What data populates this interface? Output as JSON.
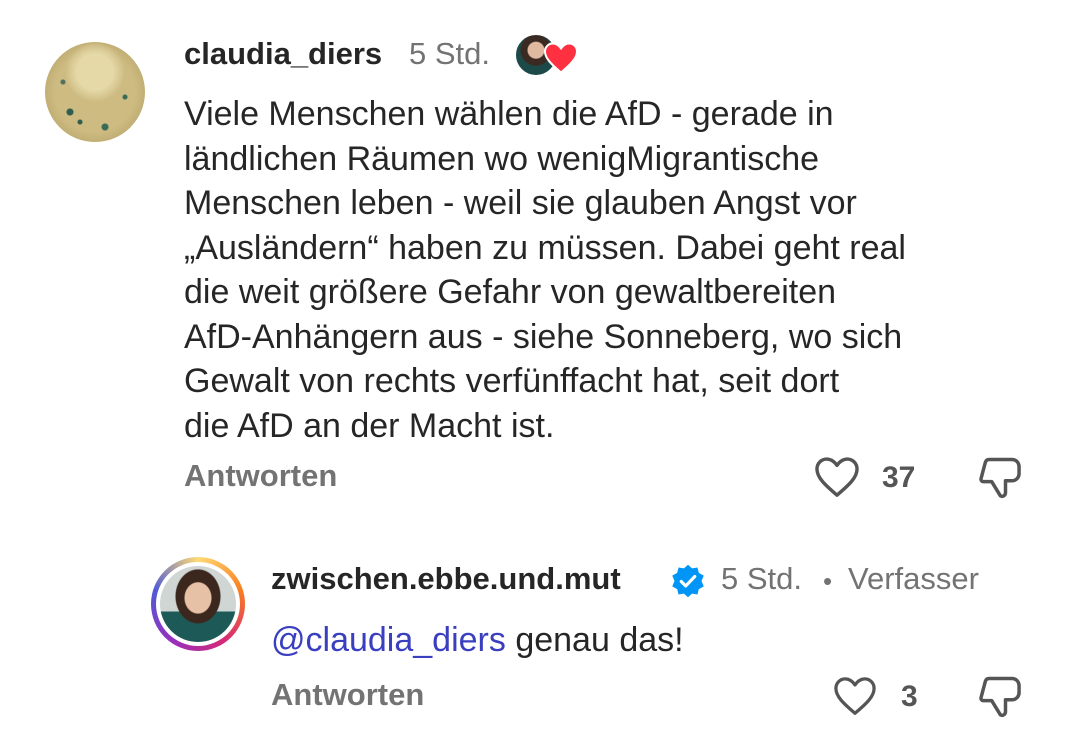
{
  "comment": {
    "username": "claudia_diers",
    "time": "5 Std.",
    "lines": [
      "Viele Menschen wählen die AfD - gerade in",
      "ländlichen Räumen wo wenigMigrantische",
      "Menschen leben - weil sie glauben Angst vor",
      "„Ausländern“ haben zu müssen. Dabei geht real",
      "die weit größere Gefahr von gewaltbereiten",
      "AfD-Anhängern aus - siehe Sonneberg, wo sich",
      "Gewalt von rechts verfünffacht hat, seit dort",
      "die AfD an der Macht ist."
    ],
    "reply_label": "Antworten",
    "like_count": "37",
    "icons": {
      "like": "heart-icon",
      "dislike": "thumb-down-icon",
      "liked_by_author": "heart-filled-icon"
    },
    "accent_heart": "#ff3040"
  },
  "reply": {
    "username": "zwischen.ebbe.und.mut",
    "time": "5 Std.",
    "separator": "•",
    "author_label": "Verfasser",
    "mention": "@claudia_diers",
    "text": " genau das!",
    "reply_label": "Antworten",
    "like_count": "3",
    "verified_color": "#0095f6",
    "icons": {
      "verified": "verified-badge-icon",
      "like": "heart-icon",
      "dislike": "thumb-down-icon"
    }
  }
}
